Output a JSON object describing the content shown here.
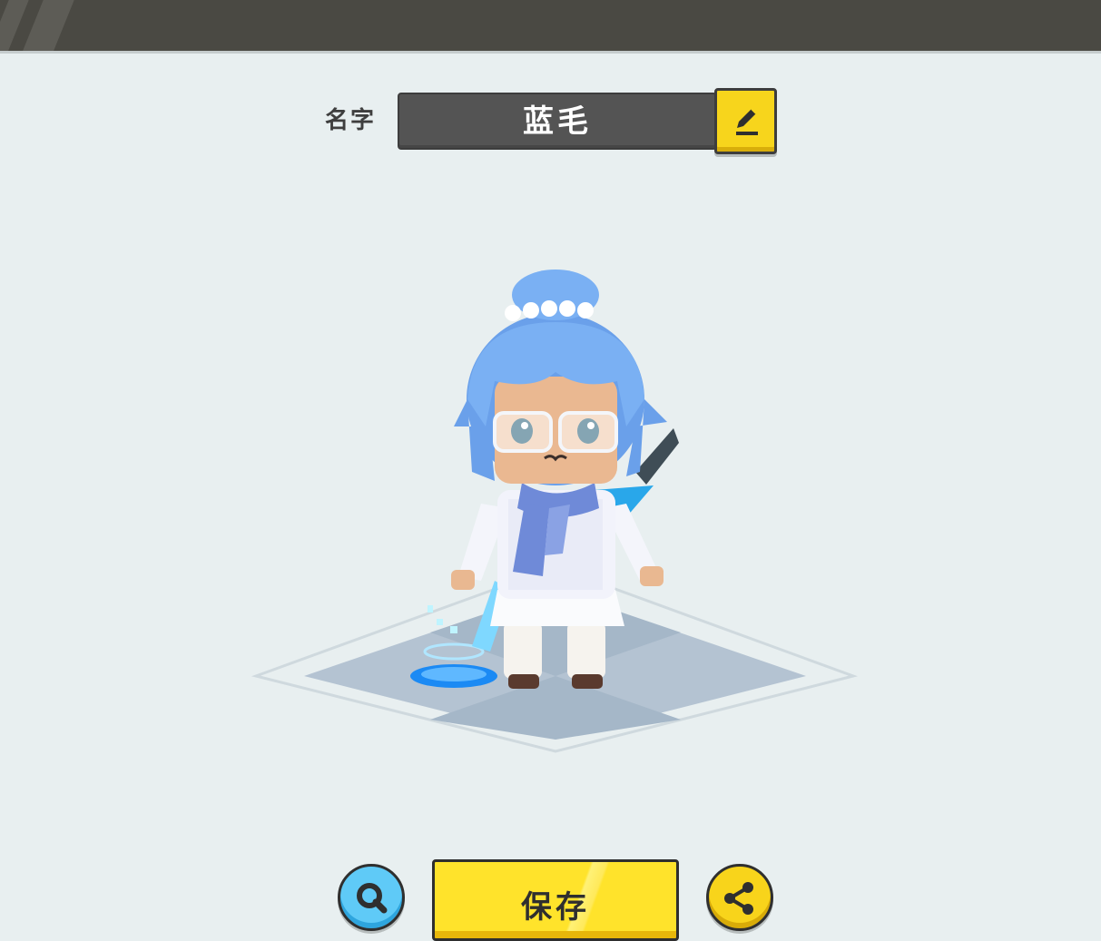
{
  "profile": {
    "name_label": "名字",
    "name_value": "蓝毛"
  },
  "icons": {
    "edit": "pencil-icon",
    "zoom": "magnifier-icon",
    "share": "share-icon"
  },
  "actions": {
    "save_label": "保存"
  },
  "colors": {
    "accent_yellow": "#f7d51c",
    "zoom_blue": "#5fcaf7",
    "topbar": "#4a4943",
    "background": "#e8eff0"
  }
}
